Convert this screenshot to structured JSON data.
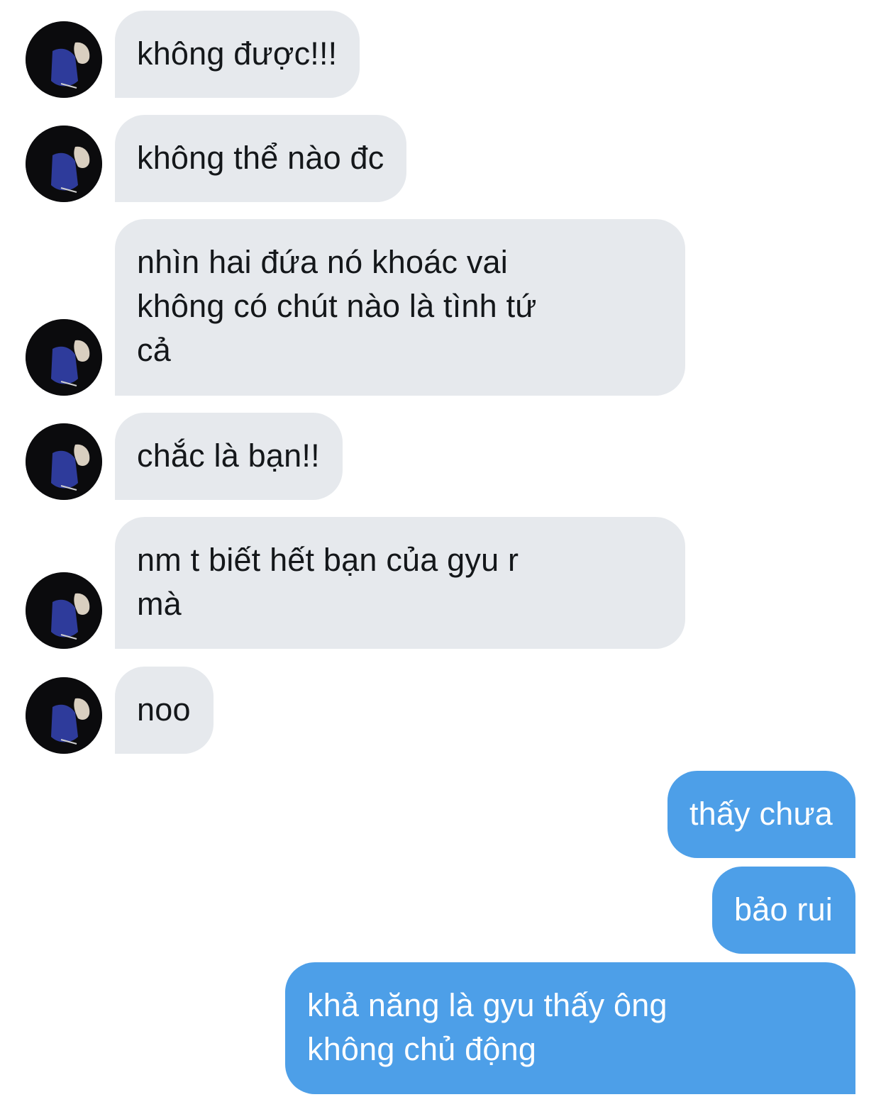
{
  "conversation": {
    "colors": {
      "incoming_bubble": "#e6e9ed",
      "incoming_text": "#14171a",
      "outgoing_bubble": "#4d9fe8",
      "outgoing_text": "#ffffff"
    },
    "avatar_icon": "user-avatar-photo",
    "messages": [
      {
        "sender": "other",
        "text": "không được!!!"
      },
      {
        "sender": "other",
        "text": "không thể nào đc"
      },
      {
        "sender": "other",
        "text": "nhìn hai đứa nó khoác vai\nkhông có chút nào là tình tứ\ncả"
      },
      {
        "sender": "other",
        "text": "chắc là bạn!!"
      },
      {
        "sender": "other",
        "text": "nm t biết hết bạn của gyu r\nmà"
      },
      {
        "sender": "other",
        "text": "noo"
      },
      {
        "sender": "me",
        "text": "thấy chưa"
      },
      {
        "sender": "me",
        "text": "bảo rui"
      },
      {
        "sender": "me",
        "text": "khả năng là gyu thấy ông\nkhông chủ động"
      }
    ]
  }
}
